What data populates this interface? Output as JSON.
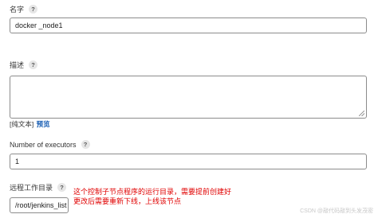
{
  "fields": {
    "name": {
      "label": "名字",
      "value": "docker _node1"
    },
    "description": {
      "label": "描述",
      "value": ""
    },
    "plain_text": {
      "prefix": "[纯文本] ",
      "preview_link": "预览"
    },
    "executors": {
      "label": "Number of executors",
      "value": "1"
    },
    "remote_root": {
      "label": "远程工作目录",
      "value": "/root/jenkins_list"
    }
  },
  "help_glyph": "?",
  "annotation": {
    "line1": "这个控制子节点程序的运行目录，需要提前创建好",
    "line2": "更改后需要重新下线，上线该节点",
    "color": "#e00000"
  },
  "watermark": "CSDN @敲代码敲到头发茂密"
}
